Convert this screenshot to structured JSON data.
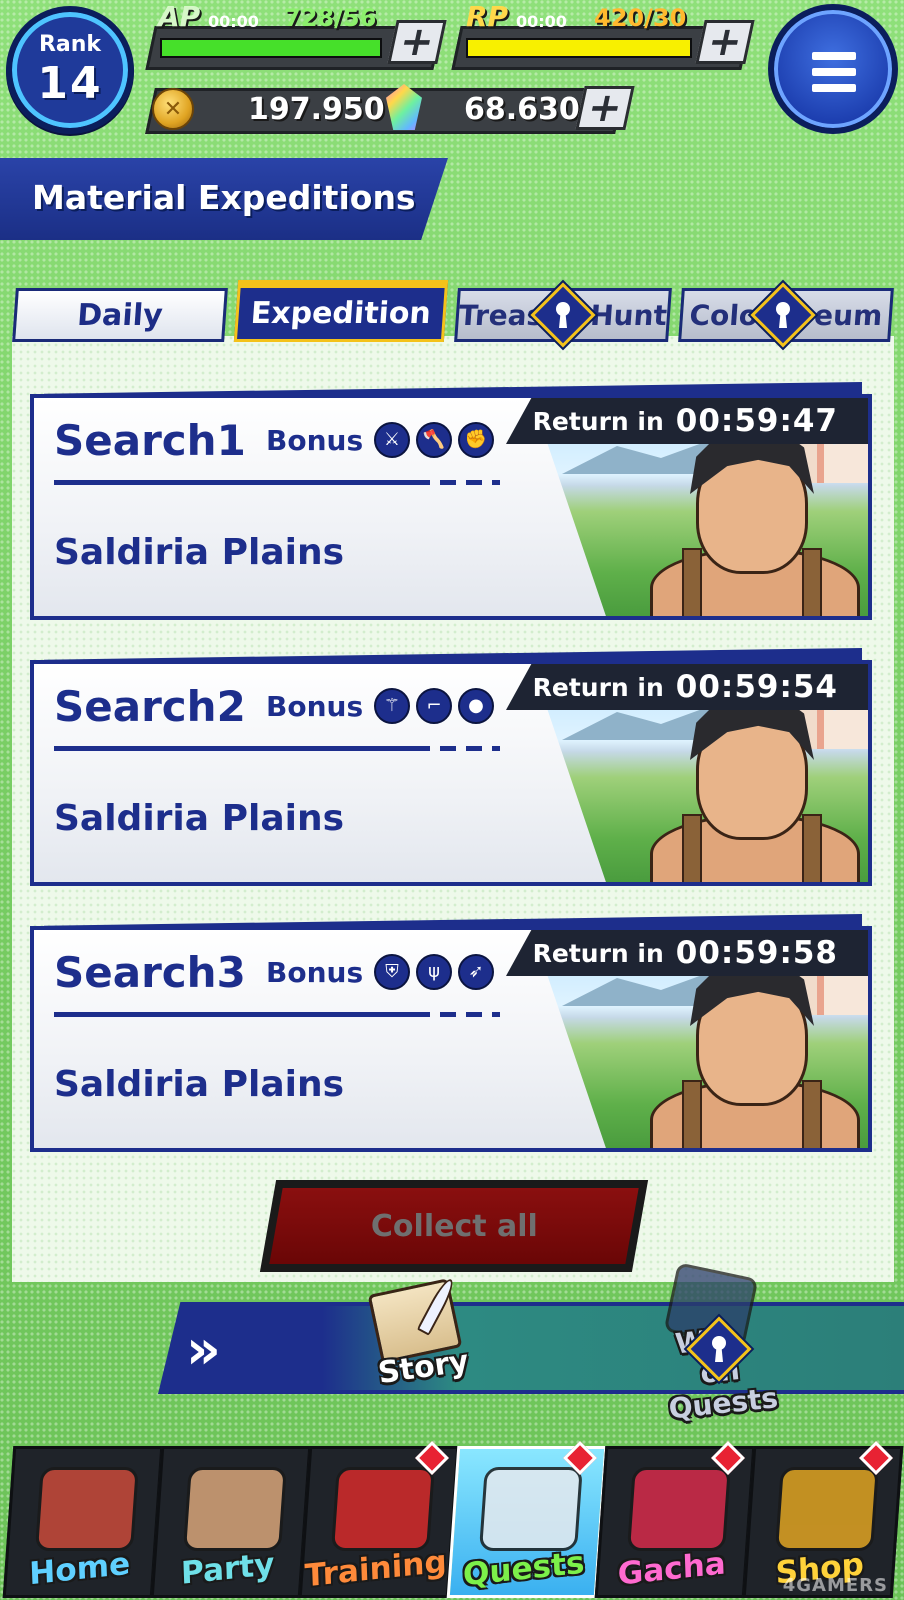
{
  "header": {
    "rank": {
      "label": "Rank",
      "value": "14"
    },
    "ap": {
      "label": "AP",
      "timer": "00:00",
      "count": "728/56",
      "fill_percent": 100,
      "color": "#46e02a"
    },
    "rp": {
      "label": "RP",
      "timer": "00:00",
      "count": "420/30",
      "fill_percent": 100,
      "color": "#f8f000"
    },
    "add_symbol": "+",
    "coins": "197.950",
    "gems": "68.630",
    "menu_icon": "hamburger-menu-icon"
  },
  "page_title": "Material Expeditions",
  "tabs": [
    {
      "label": "Daily",
      "state": "inactive"
    },
    {
      "label": "Expedition",
      "state": "active"
    },
    {
      "label": "Treas",
      "label_tail": "Hunt",
      "state": "locked"
    },
    {
      "label": "Colo",
      "label_tail": "eum",
      "state": "locked"
    }
  ],
  "searches": [
    {
      "title": "Search1",
      "bonus_label": "Bonus",
      "return_label": "Return in",
      "return_time": "00:59:47",
      "location": "Saldiria Plains",
      "bonus_icons": [
        "sword-icon",
        "axe-icon",
        "fist-icon"
      ]
    },
    {
      "title": "Search2",
      "bonus_label": "Bonus",
      "return_label": "Return in",
      "return_time": "00:59:54",
      "location": "Saldiria Plains",
      "bonus_icons": [
        "staff-icon",
        "gun-icon",
        "orb-icon"
      ]
    },
    {
      "title": "Search3",
      "bonus_label": "Bonus",
      "return_label": "Return in",
      "return_time": "00:59:58",
      "location": "Saldiria Plains",
      "bonus_icons": [
        "shield-icon",
        "trident-icon",
        "bow-icon"
      ]
    }
  ],
  "collect_all": "Collect all",
  "quest_bar": {
    "arrows": "»",
    "story": "Story",
    "weapon_line1": "We",
    "weapon_line1_tail": "on",
    "weapon_line2": "Quests"
  },
  "nav": [
    {
      "label": "Home",
      "color": "#5fd0ff",
      "notif": false
    },
    {
      "label": "Party",
      "color": "#6fe0e8",
      "notif": false
    },
    {
      "label": "Training",
      "color": "#ff8a3a",
      "notif": true
    },
    {
      "label": "Quests",
      "color": "#7cf04a",
      "notif": true,
      "active": true
    },
    {
      "label": "Gacha",
      "color": "#ff6ad0",
      "notif": true
    },
    {
      "label": "Shop",
      "color": "#ffd23a",
      "notif": true
    }
  ],
  "watermark": "4GAMERS",
  "colors": {
    "brand_navy": "#1d2e8c",
    "tab_accent": "#f4c21a",
    "collect_red": "#8a0f0f",
    "background_green": "#7fd46a"
  }
}
